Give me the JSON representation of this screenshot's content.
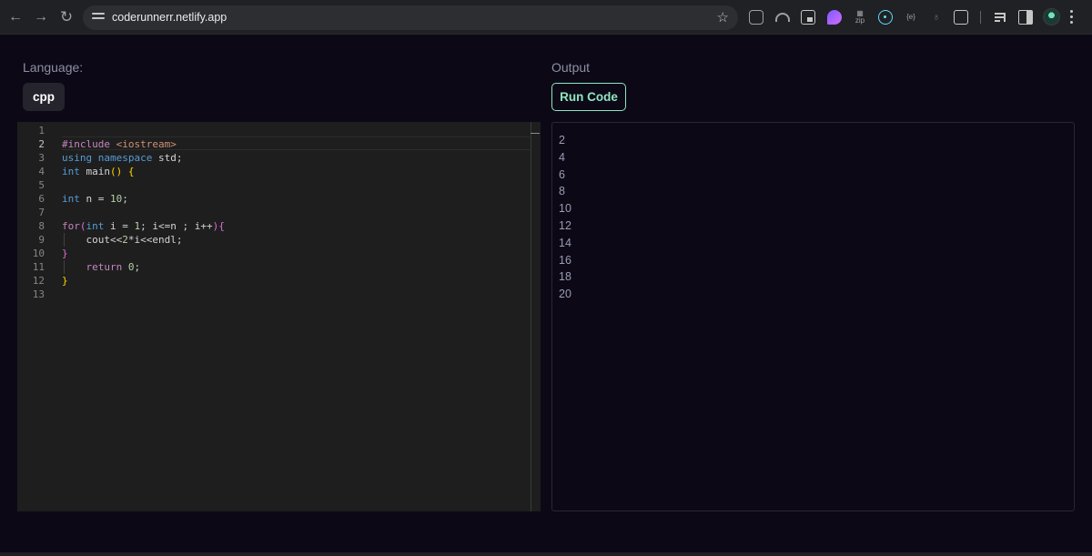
{
  "browser": {
    "url": "coderunnerr.netlify.app",
    "back_icon": "←",
    "forward_icon": "→",
    "reload_icon": "↻",
    "bookmark_icon": "☆"
  },
  "editor_panel": {
    "language_label": "Language:",
    "language_value": "cpp",
    "active_line": 2,
    "line_numbers": [
      "1",
      "2",
      "3",
      "4",
      "5",
      "6",
      "7",
      "8",
      "9",
      "10",
      "11",
      "12",
      "13"
    ],
    "code_lines": [
      "",
      "#include <iostream>",
      "using namespace std;",
      "int main() {",
      "",
      "int n = 10;",
      "",
      "for(int i = 1; i<=n ; i++){",
      "    cout<<2*i<<endl;",
      "}",
      "    return 0;",
      "}",
      ""
    ]
  },
  "output_panel": {
    "label": "Output",
    "run_button": "Run Code",
    "lines": [
      "2",
      "4",
      "6",
      "8",
      "10",
      "12",
      "14",
      "16",
      "18",
      "20"
    ]
  },
  "colors": {
    "background": "#0c0816",
    "accent": "#8fe6c0",
    "editor_bg": "#1e1e1e"
  }
}
